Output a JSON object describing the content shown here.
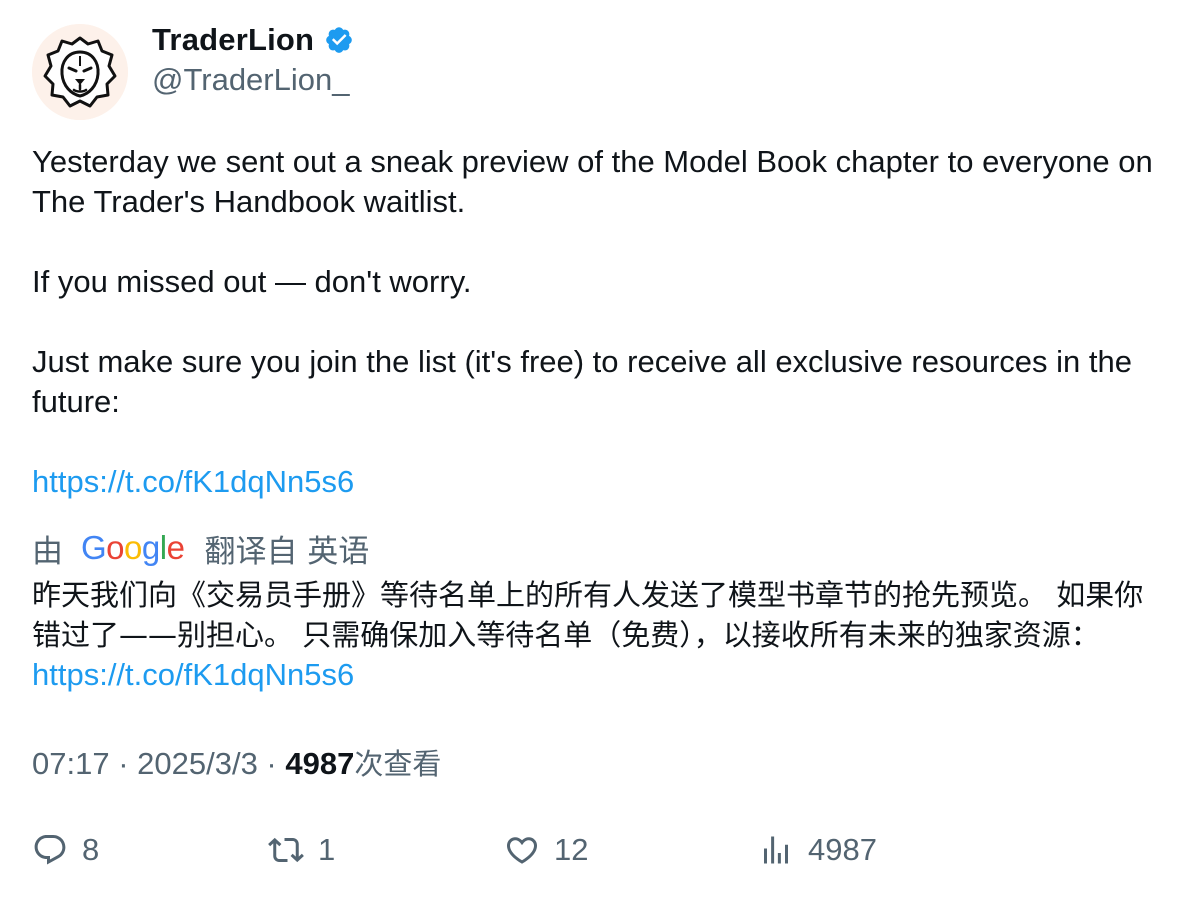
{
  "author": {
    "display_name": "TraderLion",
    "handle": "@TraderLion_",
    "verified_icon": "verified-badge-icon",
    "accent_color": "#1d9bf0"
  },
  "tweet": {
    "paragraphs": "Yesterday we sent out a sneak preview of the Model Book chapter to everyone on The Trader's Handbook waitlist.\n\nIf you missed out — don't worry.\n\nJust make sure you join the list (it's free) to receive all exclusive resources in the future:",
    "link": "https://t.co/fK1dqNn5s6"
  },
  "translation": {
    "prefix": "由",
    "provider_logo": "Google",
    "suffix": "翻译自 英语",
    "text": "昨天我们向《交易员手册》等待名单上的所有人发送了模型书章节的抢先预览。 如果你错过了——别担心。 只需确保加入等待名单（免费），以接收所有未来的独家资源： ",
    "link": "https://t.co/fK1dqNn5s6"
  },
  "meta": {
    "time": "07:17",
    "separator": " · ",
    "date": "2025/3/3",
    "views_count": "4987",
    "views_label": "次查看"
  },
  "actions": {
    "replies": "8",
    "reposts": "1",
    "likes": "12",
    "views": "4987"
  }
}
